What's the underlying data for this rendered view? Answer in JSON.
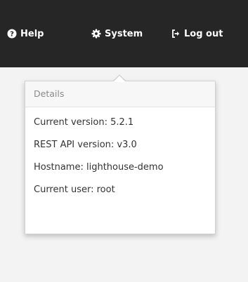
{
  "nav": {
    "help": {
      "label": "Help",
      "icon": "question-circle-icon"
    },
    "system": {
      "label": "System",
      "icon": "gear-icon"
    },
    "logout": {
      "label": "Log out",
      "icon": "sign-out-icon"
    }
  },
  "system_menu": {
    "header": "Details",
    "items": [
      {
        "label": "Current version: 5.2.1"
      },
      {
        "label": "REST API version: v3.0"
      },
      {
        "label": "Hostname: lighthouse-demo"
      },
      {
        "label": "Current user: root"
      }
    ]
  },
  "colors": {
    "topbar": "#262626",
    "topbar_text": "#ffffff",
    "page_background": "#f3f3f3"
  }
}
